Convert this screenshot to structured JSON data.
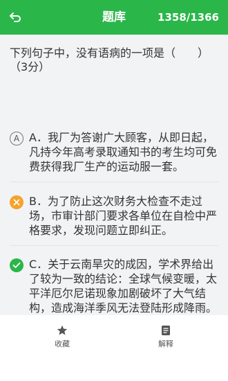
{
  "header": {
    "title": "题库",
    "counter": "1358/1366",
    "back_icon": "back-arrow-icon",
    "bar_color": "#2bb64a"
  },
  "question": {
    "text": "下列句子中，没有语病的一项是（　　）（3分）"
  },
  "options": [
    {
      "marker": "A",
      "state": "unselected",
      "icon": "option-a-circle-icon",
      "text": "A．我厂为答谢广大顾客，从即日起，凡持今年高考录取通知书的考生均可免费获得我厂生产的运动服一套。"
    },
    {
      "marker": "",
      "state": "wrong",
      "icon": "wrong-x-icon",
      "color": "#f5a22d",
      "text": "B．为了防止这次财务大检查不走过场，市审计部门要求各单位在自检中严格要求，发现问题立即纠正。"
    },
    {
      "marker": "",
      "state": "correct",
      "icon": "correct-check-icon",
      "color": "#2bb64a",
      "text": "C．关于云南旱灾的成因，学术界给出了较为一致的结论：全球气候变暖，太平洋厄尔尼诺现象加剧破坏了大气结构，造成海洋季风无法登陆形成降雨。"
    }
  ],
  "bottom_bar": {
    "favorite_label": "收藏",
    "favorite_icon": "star-icon",
    "explain_label": "解释",
    "explain_icon": "document-icon"
  }
}
